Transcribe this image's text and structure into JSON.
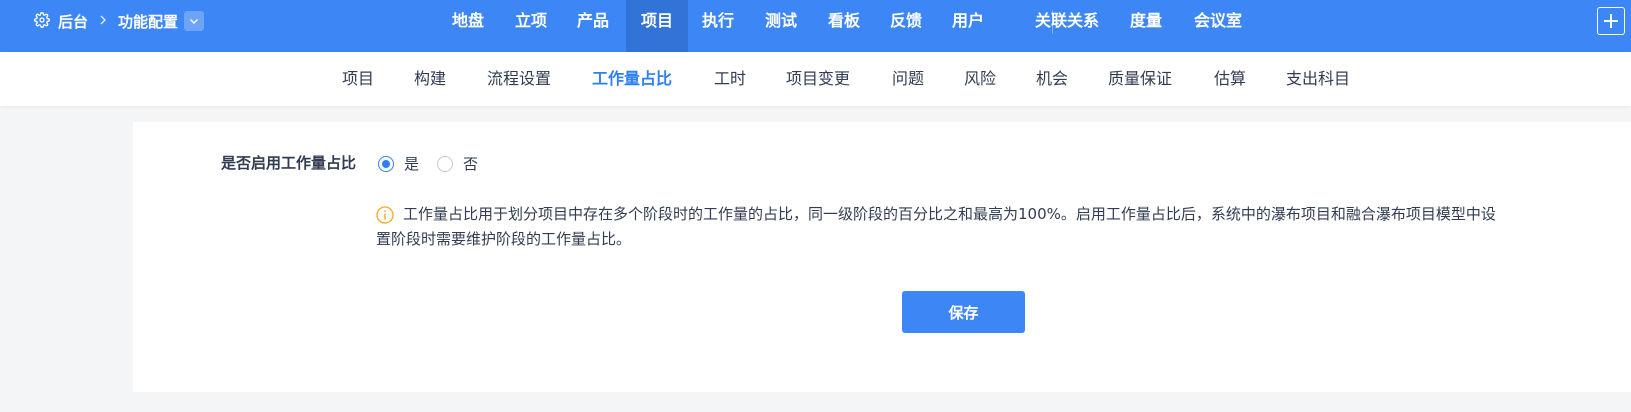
{
  "breadcrumb": {
    "root": "后台",
    "current": "功能配置"
  },
  "main_nav": {
    "items": [
      {
        "label": "地盘"
      },
      {
        "label": "立项"
      },
      {
        "label": "产品"
      },
      {
        "label": "项目",
        "active": true
      },
      {
        "label": "执行"
      },
      {
        "label": "测试"
      },
      {
        "label": "看板"
      },
      {
        "label": "反馈"
      },
      {
        "label": "用户"
      },
      {
        "label": "关联关系"
      },
      {
        "label": "度量"
      },
      {
        "label": "会议室"
      }
    ]
  },
  "sub_nav": {
    "items": [
      {
        "label": "项目"
      },
      {
        "label": "构建"
      },
      {
        "label": "流程设置"
      },
      {
        "label": "工作量占比",
        "active": true
      },
      {
        "label": "工时"
      },
      {
        "label": "项目变更"
      },
      {
        "label": "问题"
      },
      {
        "label": "风险"
      },
      {
        "label": "机会"
      },
      {
        "label": "质量保证"
      },
      {
        "label": "估算"
      },
      {
        "label": "支出科目"
      }
    ]
  },
  "form": {
    "label": "是否启用工作量占比",
    "options": [
      {
        "label": "是",
        "checked": true
      },
      {
        "label": "否",
        "checked": false
      }
    ],
    "tip_line1": "工作量占比用于划分项目中存在多个阶段时的工作量的占比，同一级阶段的百分比之和最高为100%。启用工作量占比后，系统中的瀑布项目和融合瀑布项目模型中设",
    "tip_line2": "置阶段时需要维护阶段的工作量占比。",
    "save_label": "保存"
  },
  "icons": {
    "settings": "gear-icon",
    "breadcrumb_separator": "chevron-right-icon",
    "dropdown": "chevron-down-icon",
    "add": "plus-icon",
    "info": "info-icon"
  },
  "colors": {
    "topbar": "#3d86f5",
    "active_nav_bg": "#3273d8",
    "accent": "#2e7ff3",
    "info_icon": "#f5a623"
  }
}
